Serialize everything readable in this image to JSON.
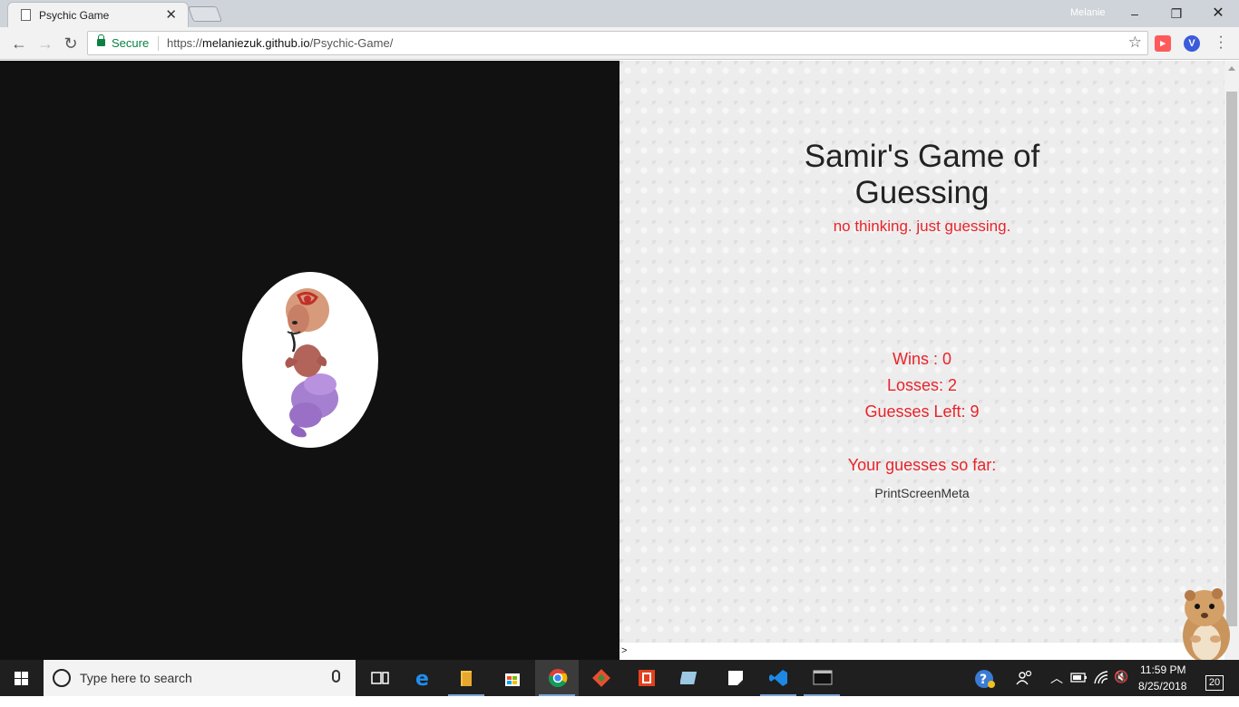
{
  "browser": {
    "tab_title": "Psychic Game",
    "profile_name": "Melanie",
    "secure_label": "Secure",
    "url_scheme": "https://",
    "url_host": "melaniezuk.github.io",
    "url_path": "/Psychic-Game/"
  },
  "game": {
    "title": "Samir's Game of Guessing",
    "tagline": "no thinking. just guessing.",
    "wins_text": "Wins : 0",
    "losses_text": "Losses: 2",
    "guesses_left_text": "Guesses Left: 9",
    "guesses_heading": "Your guesses so far:",
    "guesses_value": "PrintScreenMeta",
    "console_prompt": ">"
  },
  "taskbar": {
    "search_placeholder": "Type here to search",
    "time": "11:59 PM",
    "date": "8/25/2018",
    "notifications": "20"
  },
  "colors": {
    "accent_red": "#e8232a",
    "left_bg": "#111111",
    "taskbar_bg": "#1f1f1f"
  }
}
